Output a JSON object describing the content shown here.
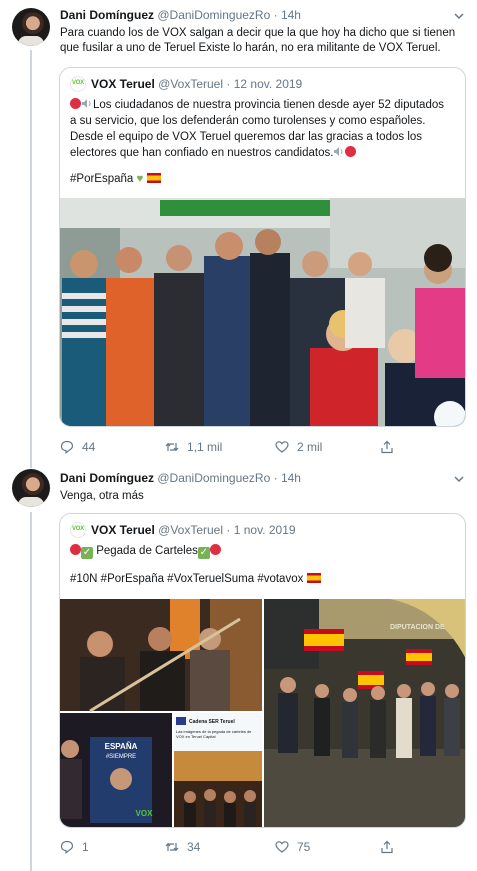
{
  "tweets": [
    {
      "author_name": "Dani Domínguez",
      "author_handle": "@DaniDominguezRo",
      "separator": "·",
      "time": "14h",
      "text": "Para cuando los de VOX salgan a decir que la que hoy ha dicho que si tienen que fusilar a uno de Teruel Existe lo harán, no era militante de VOX Teruel.",
      "quote": {
        "avatar_text": "VOX",
        "name": "VOX Teruel",
        "handle": "@VoxTeruel",
        "separator": "·",
        "date": "12 nov. 2019",
        "text": "Los ciudadanos de nuestra provincia tienen desde ayer 52 diputados a su servicio, que los defenderán como turolenses y como españoles. Desde el equipo de VOX Teruel queremos dar las gracias a todos los electores que han confiado en nuestros candidatos.",
        "hashtags": "#PorEspaña"
      },
      "stats": {
        "replies": "44",
        "retweets": "1,1 mil",
        "likes": "2 mil"
      }
    },
    {
      "author_name": "Dani Domínguez",
      "author_handle": "@DaniDominguezRo",
      "separator": "·",
      "time": "14h",
      "text": "Venga, otra más",
      "quote": {
        "avatar_text": "VOX",
        "name": "VOX Teruel",
        "handle": "@VoxTeruel",
        "separator": "·",
        "date": "1 nov. 2019",
        "title": "Pegada de Carteles",
        "hashtags": "#10N #PorEspaña #VoxTeruelSuma #votavox",
        "photo_texts": {
          "poster_line1": "ESPAÑA",
          "poster_line2": "#SIEMPRE",
          "poster_logo": "VOX",
          "card_source": "Cadena SER Teruel",
          "card_caption": "Las imágenes de la pegada de carteles de VOX en Teruel Capital",
          "building_sign": "DIPUTACION DE"
        }
      },
      "stats": {
        "replies": "1",
        "retweets": "34",
        "likes": "75"
      }
    }
  ],
  "colors": {
    "text": "#14171a",
    "secondary": "#657786",
    "border": "#ccd6dd",
    "vox_green": "#5ac72b",
    "spain_red": "#c60b1e",
    "spain_yellow": "#ffc400"
  }
}
